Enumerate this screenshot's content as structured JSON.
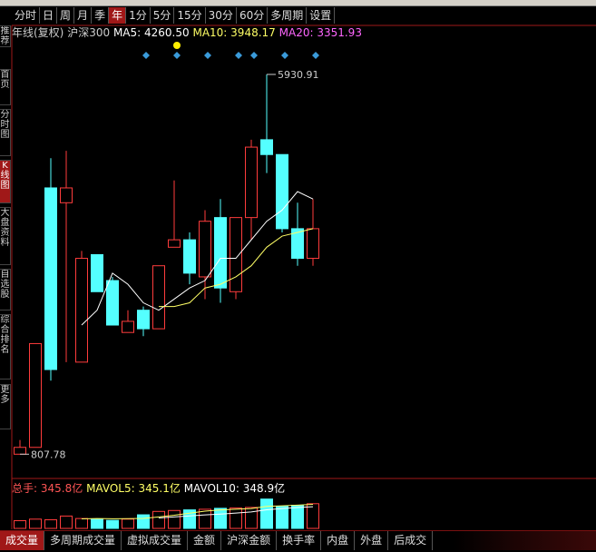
{
  "period_bar": [
    {
      "label": "分时",
      "active": false
    },
    {
      "label": "日",
      "active": false
    },
    {
      "label": "周",
      "active": false
    },
    {
      "label": "月",
      "active": false
    },
    {
      "label": "季",
      "active": false
    },
    {
      "label": "年",
      "active": true
    },
    {
      "label": "1分",
      "active": false
    },
    {
      "label": "5分",
      "active": false
    },
    {
      "label": "15分",
      "active": false
    },
    {
      "label": "30分",
      "active": false
    },
    {
      "label": "60分",
      "active": false
    },
    {
      "label": "多周期",
      "active": false
    },
    {
      "label": "设置",
      "active": false
    }
  ],
  "sidebar_tabs": [
    {
      "label": "推荐",
      "active": false
    },
    {
      "label": "首页",
      "active": false
    },
    {
      "label": "分时图",
      "active": false
    },
    {
      "label": "K线图",
      "active": true
    },
    {
      "label": "大盘资料",
      "active": false
    },
    {
      "label": "自选股",
      "active": false
    },
    {
      "label": "综合排名",
      "active": false
    },
    {
      "label": "更多",
      "active": false
    }
  ],
  "legend": {
    "title": "年线(复权)",
    "index": "沪深300",
    "ma5_label": "MA5:",
    "ma5_value": "4260.50",
    "ma10_label": "MA10:",
    "ma10_value": "3948.17",
    "ma20_label": "MA20:",
    "ma20_value": "3351.93"
  },
  "vol_legend": {
    "label": "总手:",
    "value": "345.8亿",
    "mavol5_label": "MAVOL5:",
    "mavol5_value": "345.1亿",
    "mavol10_label": "MAVOL10:",
    "mavol10_value": "348.9亿"
  },
  "bottom_tabs": [
    {
      "label": "成交量",
      "active": true
    },
    {
      "label": "多周期成交量",
      "active": false
    },
    {
      "label": "虚拟成交量",
      "active": false
    },
    {
      "label": "金额",
      "active": false
    },
    {
      "label": "沪深金额",
      "active": false
    },
    {
      "label": "换手率",
      "active": false
    },
    {
      "label": "内盘",
      "active": false
    },
    {
      "label": "外盘",
      "active": false
    },
    {
      "label": "后成交",
      "active": false
    }
  ],
  "colors": {
    "up": "#ff3c3c",
    "down": "#54ffff",
    "ma5": "#ffffff",
    "ma10": "#ffff66",
    "ma20": "#ff66ff",
    "frame": "#a01818",
    "marker": "#3a9ad9",
    "dot": "#ffee00"
  },
  "chart_data": {
    "type": "candlestick",
    "price_range": [
      750,
      6200
    ],
    "candles": [
      {
        "o": 807.78,
        "h": 1000,
        "l": 807.78,
        "c": 900
      },
      {
        "o": 900,
        "h": 2300,
        "l": 900,
        "c": 2300
      },
      {
        "o": 4400,
        "h": 4800,
        "l": 1800,
        "c": 1950
      },
      {
        "o": 4200,
        "h": 4900,
        "l": 2050,
        "c": 4400
      },
      {
        "o": 2050,
        "h": 3550,
        "l": 2050,
        "c": 3450
      },
      {
        "o": 3500,
        "h": 3500,
        "l": 3000,
        "c": 3000
      },
      {
        "o": 3150,
        "h": 3200,
        "l": 2550,
        "c": 2550
      },
      {
        "o": 2450,
        "h": 2750,
        "l": 2500,
        "c": 2600
      },
      {
        "o": 2750,
        "h": 2800,
        "l": 2400,
        "c": 2500
      },
      {
        "o": 2500,
        "h": 3350,
        "l": 2500,
        "c": 3350
      },
      {
        "o": 3600,
        "h": 4500,
        "l": 3600,
        "c": 3700
      },
      {
        "o": 3700,
        "h": 3800,
        "l": 3100,
        "c": 3250
      },
      {
        "o": 3200,
        "h": 4100,
        "l": 2900,
        "c": 3950
      },
      {
        "o": 4000,
        "h": 4250,
        "l": 2850,
        "c": 3050
      },
      {
        "o": 3000,
        "h": 4000,
        "l": 2900,
        "c": 4000
      },
      {
        "o": 4000,
        "h": 5050,
        "l": 3700,
        "c": 4950
      },
      {
        "o": 5050,
        "h": 5930.91,
        "l": 4600,
        "c": 4850
      },
      {
        "o": 4850,
        "h": 4850,
        "l": 3800,
        "c": 3850
      },
      {
        "o": 3850,
        "h": 4200,
        "l": 3350,
        "c": 3450
      },
      {
        "o": 3450,
        "h": 4250,
        "l": 3350,
        "c": 3850
      }
    ],
    "ma5": [
      null,
      null,
      null,
      null,
      2550,
      2750,
      3250,
      3100,
      2850,
      2750,
      2900,
      3050,
      3150,
      3450,
      3450,
      3700,
      3950,
      4100,
      4350,
      4250
    ],
    "ma10": [
      null,
      null,
      null,
      null,
      null,
      null,
      null,
      null,
      null,
      2800,
      2800,
      2850,
      3050,
      3100,
      3200,
      3350,
      3600,
      3750,
      3800,
      3850
    ],
    "annotations": [
      {
        "label": "5930.91",
        "value": 5930.91
      },
      {
        "label": "807.78",
        "value": 807.78
      }
    ],
    "markers_above": [
      9,
      11,
      13,
      15,
      16,
      18,
      20
    ],
    "dot_above": 11,
    "volume": [
      0.25,
      0.3,
      0.28,
      0.4,
      0.32,
      0.3,
      0.26,
      0.3,
      0.44,
      0.55,
      0.58,
      0.6,
      0.62,
      0.65,
      0.66,
      0.68,
      0.95,
      0.72,
      0.75,
      0.8
    ],
    "volume_up": [
      true,
      true,
      true,
      true,
      true,
      false,
      false,
      true,
      false,
      true,
      true,
      false,
      true,
      false,
      true,
      true,
      false,
      false,
      false,
      true
    ]
  }
}
